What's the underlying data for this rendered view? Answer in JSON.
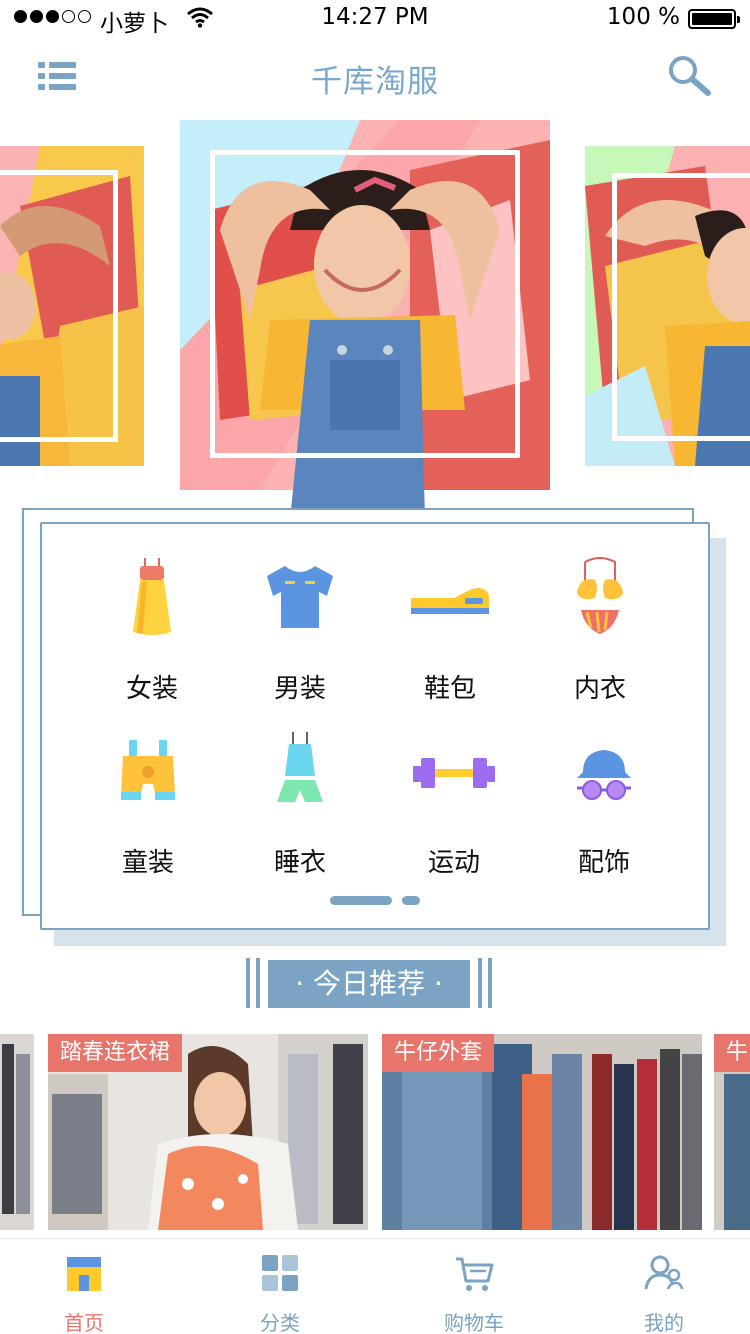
{
  "status_bar": {
    "carrier": "小萝卜",
    "time": "14:27 PM",
    "battery": "100 %"
  },
  "nav": {
    "title": "千库淘服",
    "menu_icon": "list-icon",
    "search_icon": "search-icon"
  },
  "categories": [
    {
      "label": "女装",
      "icon": "dress-icon"
    },
    {
      "label": "男装",
      "icon": "tshirt-icon"
    },
    {
      "label": "鞋包",
      "icon": "shoe-icon"
    },
    {
      "label": "内衣",
      "icon": "bikini-icon"
    },
    {
      "label": "童装",
      "icon": "kids-overalls-icon"
    },
    {
      "label": "睡衣",
      "icon": "pajamas-icon"
    },
    {
      "label": "运动",
      "icon": "dumbbell-icon"
    },
    {
      "label": "配饰",
      "icon": "hat-glasses-icon"
    }
  ],
  "recommend": {
    "title": "· 今日推荐 ·"
  },
  "products": [
    {
      "tag": "踏春连衣裙"
    },
    {
      "tag": "牛仔外套"
    },
    {
      "tag": "牛"
    }
  ],
  "tabbar": [
    {
      "label": "首页",
      "icon": "home-icon",
      "active": true
    },
    {
      "label": "分类",
      "icon": "category-grid-icon",
      "active": false
    },
    {
      "label": "购物车",
      "icon": "cart-icon",
      "active": false
    },
    {
      "label": "我的",
      "icon": "user-icon",
      "active": false
    }
  ],
  "colors": {
    "accent": "#7ba3c3",
    "active": "#e8756b",
    "title": "#7aa8cc"
  }
}
